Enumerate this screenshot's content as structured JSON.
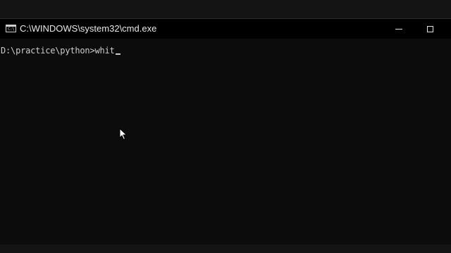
{
  "window": {
    "title": "C:\\WINDOWS\\system32\\cmd.exe",
    "icon": "cmd-icon",
    "icon_glyph": "C:\\"
  },
  "controls": {
    "minimize_icon": "minimize-icon",
    "maximize_icon": "maximize-icon"
  },
  "console": {
    "prompt": "D:\\practice\\python>",
    "input": "whit"
  },
  "colors": {
    "background": "#0c0c0c",
    "text": "#cccccc",
    "titlebar": "#000000"
  }
}
